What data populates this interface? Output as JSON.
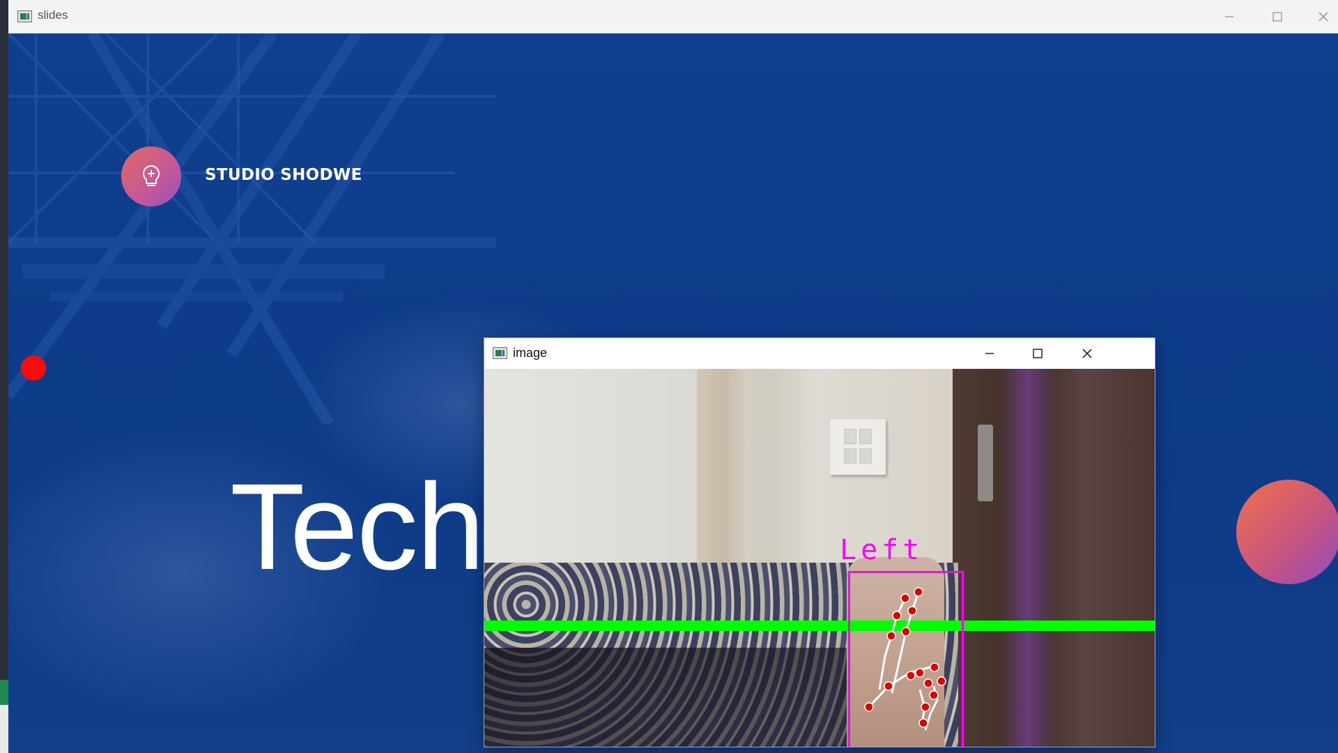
{
  "main_window": {
    "title": "slides",
    "controls": [
      "minimize",
      "maximize",
      "close"
    ]
  },
  "slide": {
    "brand": "STUDIO SHODWE",
    "heading": "Tech"
  },
  "image_window": {
    "title": "image",
    "controls": [
      "minimize",
      "maximize",
      "close"
    ],
    "hand_label": "Left"
  },
  "colors": {
    "slide_background": "#0f3d8c",
    "pointer_dot": "#ff0a0a",
    "hand_box": "#ff00ff",
    "threshold_line": "#00ff00",
    "landmark": "#e00000"
  },
  "icons": {
    "app": "window-app-icon",
    "logo": "lightbulb-icon"
  }
}
